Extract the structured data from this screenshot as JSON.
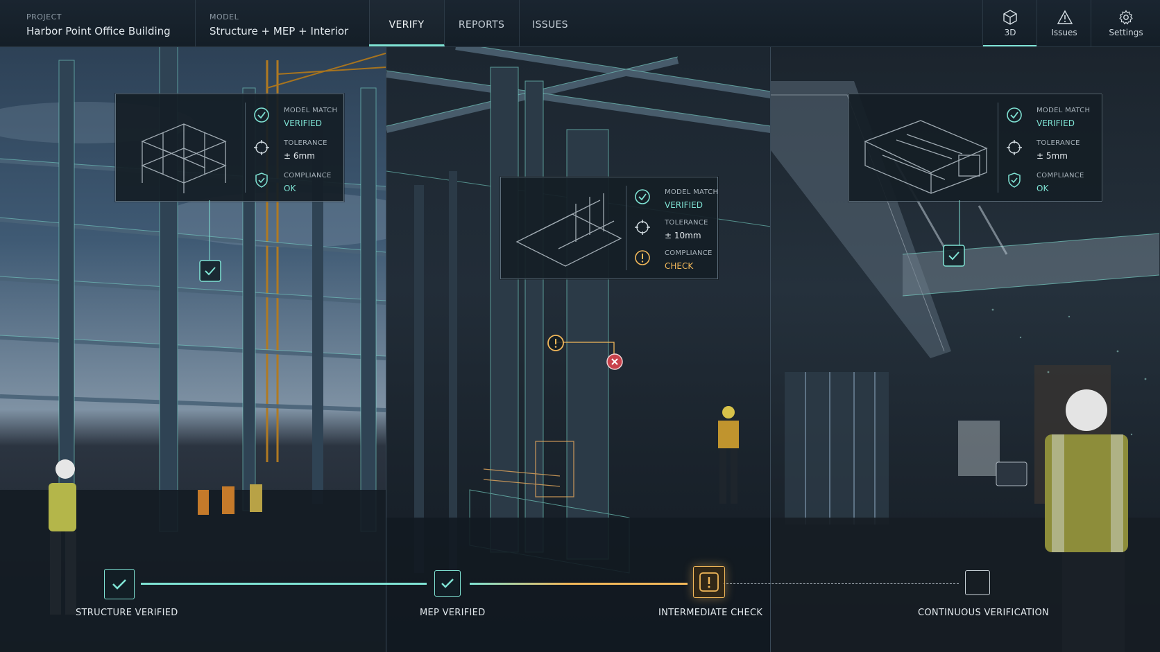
{
  "header": {
    "project_label": "PROJECT",
    "project_value": "Harbor Point Office Building",
    "model_label": "MODEL",
    "model_value": "Structure + MEP + Interior",
    "tabs": [
      {
        "label": "VERIFY",
        "active": true
      },
      {
        "label": "REPORTS",
        "active": false
      },
      {
        "label": "ISSUES",
        "active": false
      }
    ],
    "buttons": [
      {
        "label": "3D",
        "icon": "cube-icon",
        "active": true
      },
      {
        "label": "Issues",
        "icon": "warning-triangle-icon",
        "active": false
      },
      {
        "label": "Settings",
        "icon": "gear-icon",
        "active": false
      }
    ]
  },
  "cards": [
    {
      "model_match_label": "MODEL MATCH",
      "model_match_value": "VERIFIED",
      "tolerance_label": "TOLERANCE",
      "tolerance_value": "± 6mm",
      "compliance_label": "COMPLIANCE",
      "compliance_value": "OK",
      "compliance_status": "ok"
    },
    {
      "model_match_label": "MODEL MATCH",
      "model_match_value": "VERIFIED",
      "tolerance_label": "TOLERANCE",
      "tolerance_value": "± 10mm",
      "compliance_label": "COMPLIANCE",
      "compliance_value": "CHECK",
      "compliance_status": "warning"
    },
    {
      "model_match_label": "MODEL MATCH",
      "model_match_value": "VERIFIED",
      "tolerance_label": "TOLERANCE",
      "tolerance_value": "± 5mm",
      "compliance_label": "COMPLIANCE",
      "compliance_value": "OK",
      "compliance_status": "ok"
    }
  ],
  "progress": {
    "steps": [
      {
        "label": "STRUCTURE VERIFIED",
        "status": "verified",
        "icon": "checkmark-icon"
      },
      {
        "label": "MEP VERIFIED",
        "status": "verified",
        "icon": "checkmark-icon"
      },
      {
        "label": "INTERMEDIATE CHECK",
        "status": "warning",
        "icon": "exclamation-icon"
      },
      {
        "label": "CONTINUOUS VERIFICATION",
        "status": "pending",
        "icon": "empty-square-icon"
      }
    ]
  },
  "colors": {
    "accent": "#7fe3d4",
    "warning": "#f2b85a",
    "error": "#c8414b",
    "background": "#0d151d"
  }
}
